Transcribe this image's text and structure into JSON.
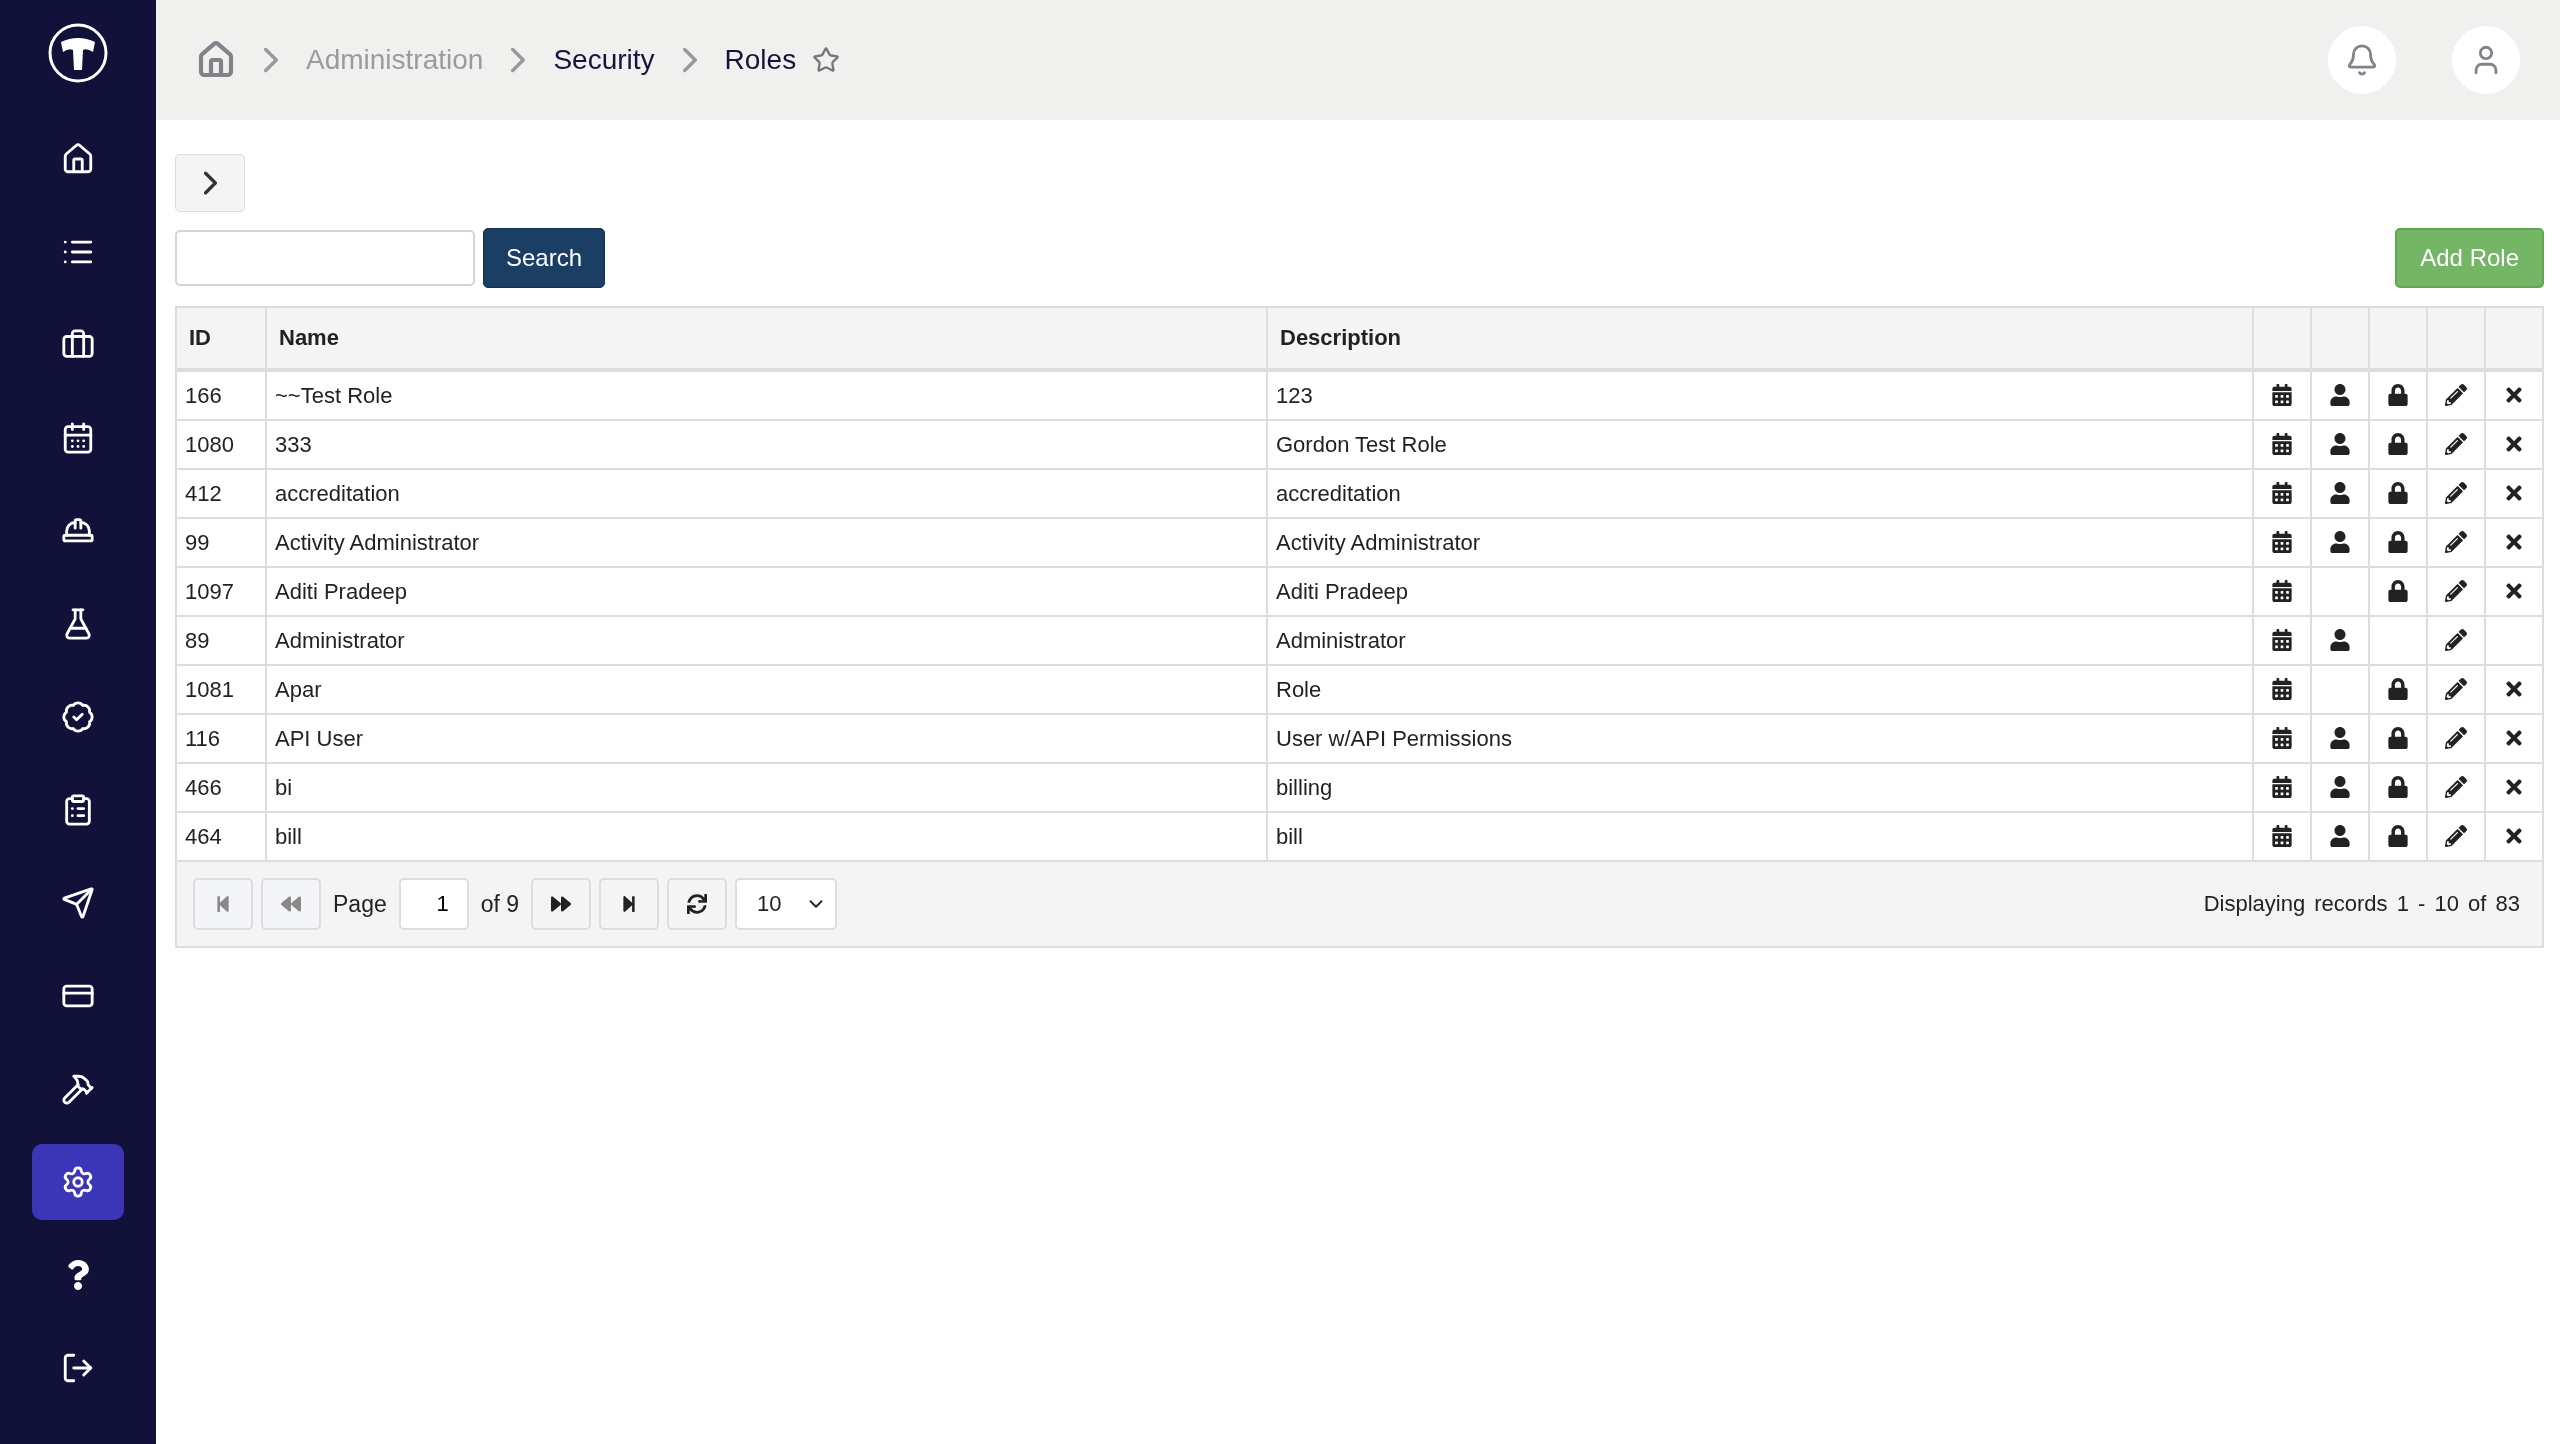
{
  "sidebar": {
    "items": [
      {
        "kind": "home",
        "selected": false
      },
      {
        "kind": "list",
        "selected": false
      },
      {
        "kind": "briefcase",
        "selected": false
      },
      {
        "kind": "calendar",
        "selected": false
      },
      {
        "kind": "worker",
        "selected": false
      },
      {
        "kind": "flask",
        "selected": false
      },
      {
        "kind": "badge",
        "selected": false
      },
      {
        "kind": "clipboard",
        "selected": false
      },
      {
        "kind": "send",
        "selected": false
      },
      {
        "kind": "card",
        "selected": false
      },
      {
        "kind": "tools",
        "selected": false
      },
      {
        "kind": "settings",
        "selected": true
      },
      {
        "kind": "help",
        "selected": false
      },
      {
        "kind": "logout",
        "selected": false
      }
    ]
  },
  "breadcrumb": [
    {
      "label": "Administration",
      "current": false
    },
    {
      "label": "Security",
      "current": true
    },
    {
      "label": "Roles",
      "current": true
    }
  ],
  "search": {
    "button": "Search"
  },
  "add_button": "Add Role",
  "table": {
    "columns": [
      "ID",
      "Name",
      "Description"
    ],
    "rows": [
      {
        "id": "166",
        "name": "~~Test Role",
        "description": "123",
        "calendar": true,
        "user": true,
        "lock": true,
        "edit": true,
        "delete": true
      },
      {
        "id": "1080",
        "name": "333",
        "description": "Gordon Test Role",
        "calendar": true,
        "user": true,
        "lock": true,
        "edit": true,
        "delete": true
      },
      {
        "id": "412",
        "name": "accreditation",
        "description": "accreditation",
        "calendar": true,
        "user": true,
        "lock": true,
        "edit": true,
        "delete": true
      },
      {
        "id": "99",
        "name": "Activity Administrator",
        "description": "Activity Administrator",
        "calendar": true,
        "user": true,
        "lock": true,
        "edit": true,
        "delete": true
      },
      {
        "id": "1097",
        "name": "Aditi Pradeep",
        "description": "Aditi Pradeep",
        "calendar": true,
        "user": false,
        "lock": true,
        "edit": true,
        "delete": true
      },
      {
        "id": "89",
        "name": "Administrator",
        "description": "Administrator",
        "calendar": true,
        "user": true,
        "lock": false,
        "edit": true,
        "delete": false
      },
      {
        "id": "1081",
        "name": "Apar",
        "description": "Role",
        "calendar": true,
        "user": false,
        "lock": true,
        "edit": true,
        "delete": true
      },
      {
        "id": "116",
        "name": "API User",
        "description": "User w/API Permissions",
        "calendar": true,
        "user": true,
        "lock": true,
        "edit": true,
        "delete": true
      },
      {
        "id": "466",
        "name": "bi",
        "description": "billing",
        "calendar": true,
        "user": true,
        "lock": true,
        "edit": true,
        "delete": true
      },
      {
        "id": "464",
        "name": "bill",
        "description": "bill",
        "calendar": true,
        "user": true,
        "lock": true,
        "edit": true,
        "delete": true
      }
    ]
  },
  "pager": {
    "first_disabled": true,
    "prev_disabled": true,
    "next_disabled": false,
    "last_disabled": false,
    "page_label": "Page",
    "page": "1",
    "of_label": "of 9",
    "per_page": "10",
    "summary": "Displaying records 1 - 10 of 83"
  }
}
